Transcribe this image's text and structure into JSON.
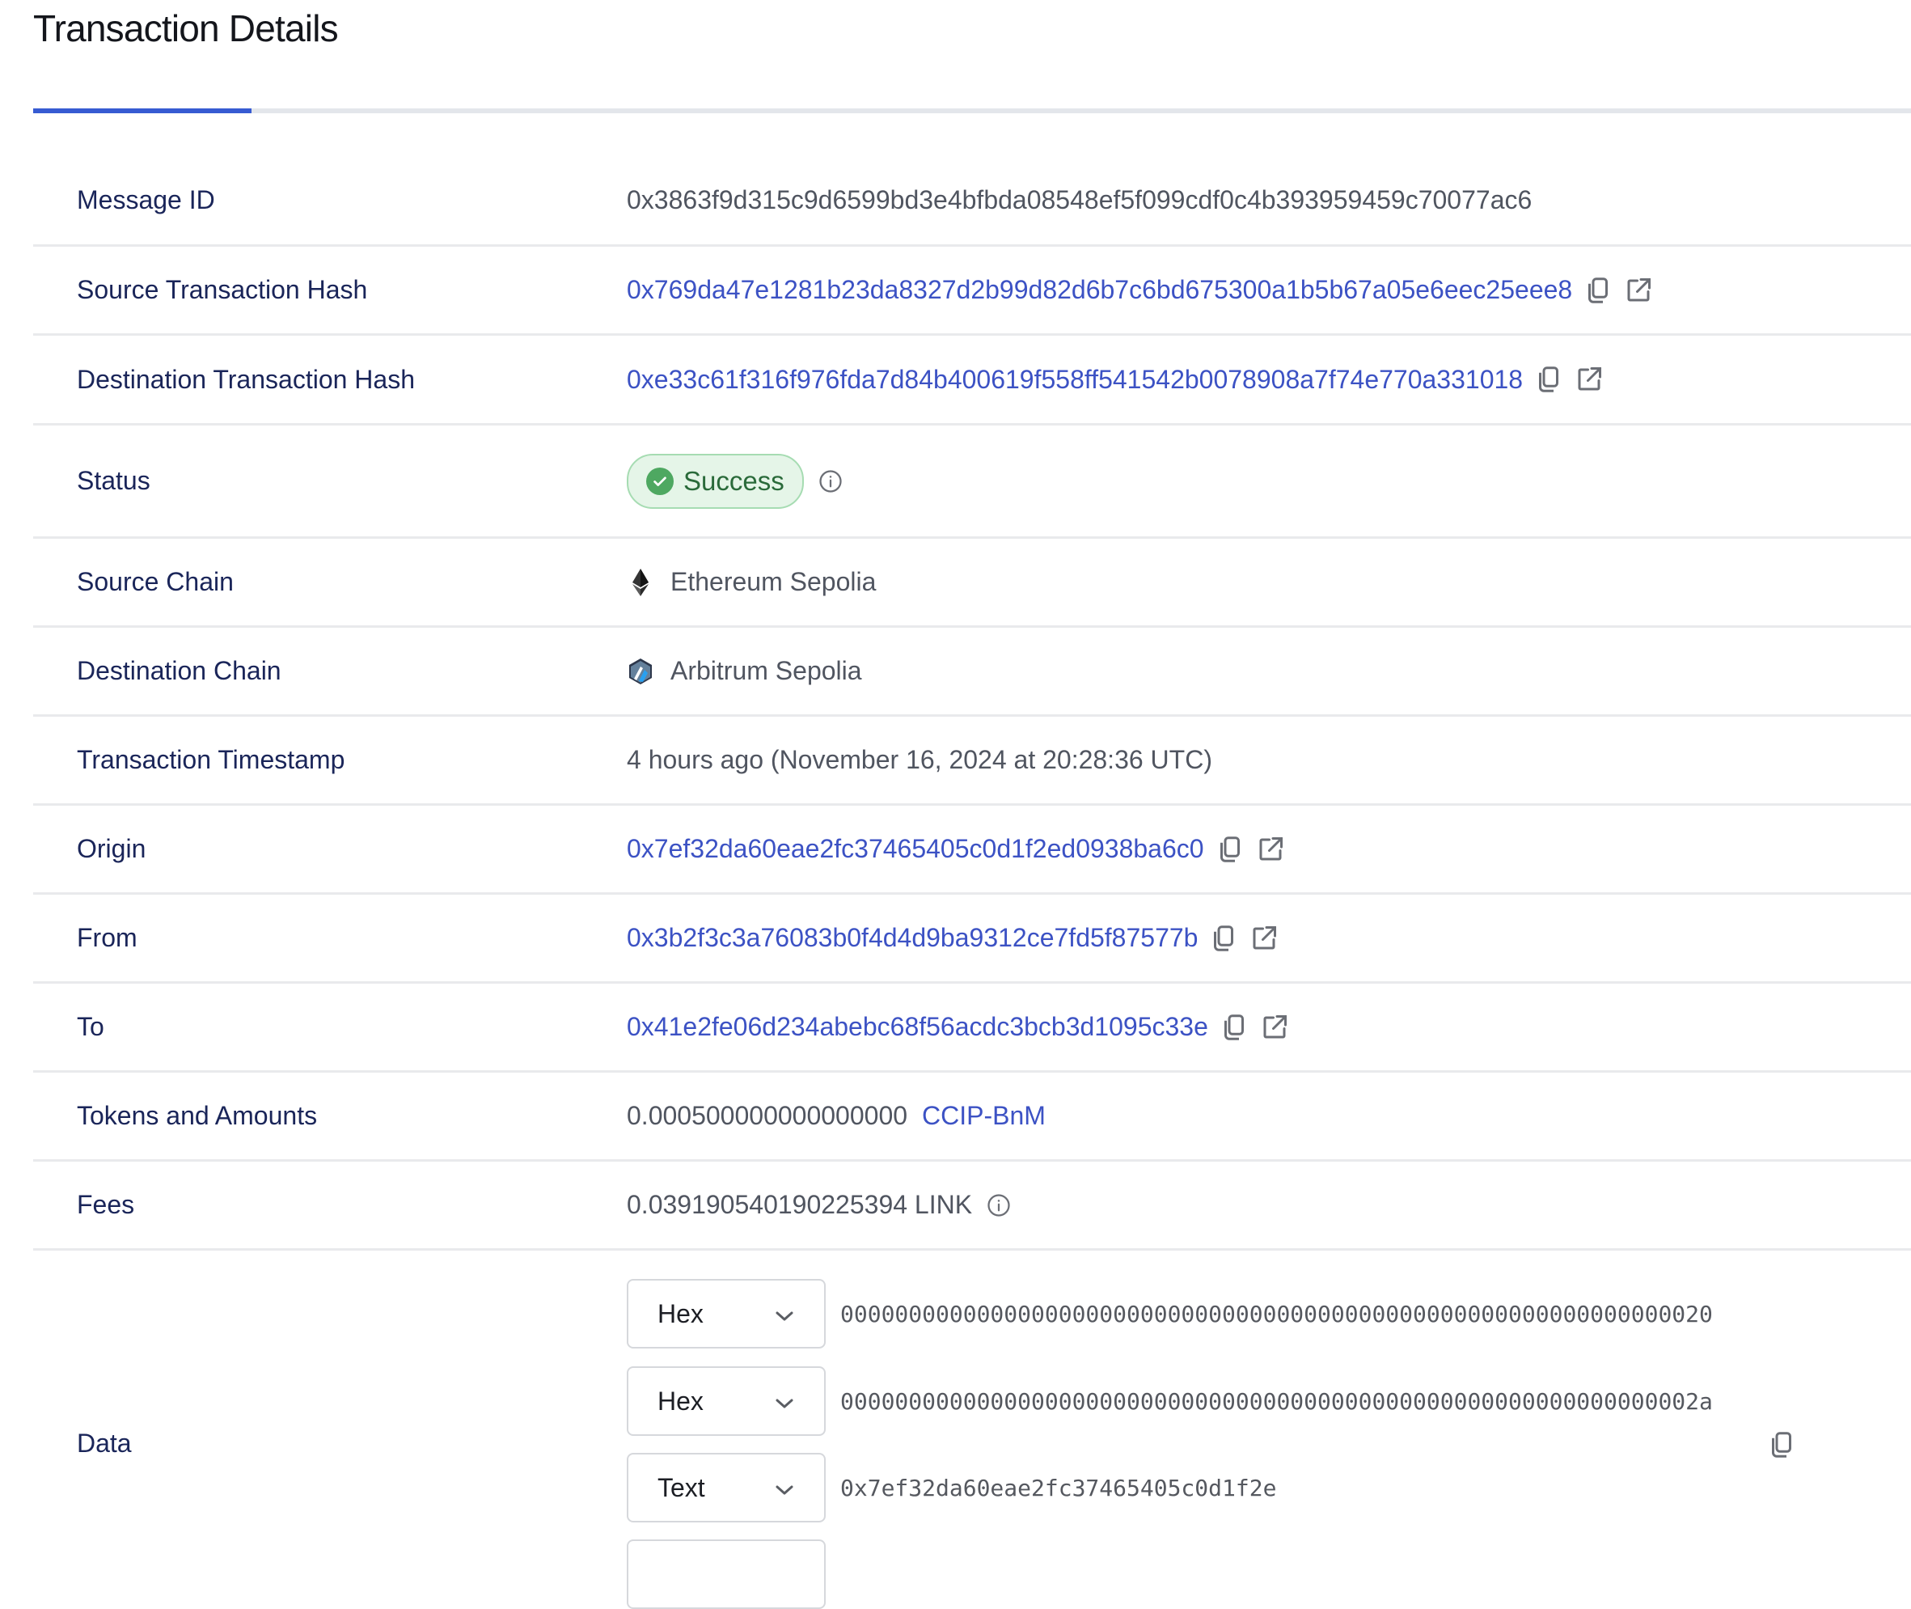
{
  "page": {
    "title": "Transaction Details",
    "active_tab_indicator": "tab-1"
  },
  "colors": {
    "accent": "#375bd2",
    "link": "#3c52c4",
    "label": "#1a2559",
    "success_bg": "#e5f5e8",
    "success_border": "#a6dcb2",
    "success_text": "#2a6a3a"
  },
  "rows": {
    "message_id": {
      "label": "Message ID",
      "value": "0x3863f9d315c9d6599bd3e4bfbda08548ef5f099cdf0c4b393959459c70077ac6"
    },
    "source_tx": {
      "label": "Source Transaction Hash",
      "value": "0x769da47e1281b23da8327d2b99d82d6b7c6bd675300a1b5b67a05e6eec25eee8",
      "copy_icon": "copy-icon",
      "link_icon": "external-link-icon"
    },
    "dest_tx": {
      "label": "Destination Transaction Hash",
      "value": "0xe33c61f316f976fda7d84b400619f558ff541542b0078908a7f74e770a331018",
      "copy_icon": "copy-icon",
      "link_icon": "external-link-icon"
    },
    "status": {
      "label": "Status",
      "value": "Success",
      "icon": "check-circle-icon",
      "info_icon": "info-icon"
    },
    "source_chain": {
      "label": "Source Chain",
      "value": "Ethereum Sepolia",
      "icon": "ethereum-icon"
    },
    "dest_chain": {
      "label": "Destination Chain",
      "value": "Arbitrum Sepolia",
      "icon": "arbitrum-icon"
    },
    "timestamp": {
      "label": "Transaction Timestamp",
      "value": "4 hours ago (November 16, 2024 at 20:28:36 UTC)"
    },
    "origin": {
      "label": "Origin",
      "value": "0x7ef32da60eae2fc37465405c0d1f2ed0938ba6c0"
    },
    "from": {
      "label": "From",
      "value": "0x3b2f3c3a76083b0f4d4d9ba9312ce7fd5f87577b"
    },
    "to": {
      "label": "To",
      "value": "0x41e2fe06d234abebc68f56acdc3bcb3d1095c33e"
    },
    "tokens": {
      "label": "Tokens and Amounts",
      "amount": "0.000500000000000000",
      "token": "CCIP-BnM"
    },
    "fees": {
      "label": "Fees",
      "value": "0.039190540190225394 LINK",
      "info_icon": "info-icon"
    },
    "data": {
      "label": "Data",
      "lines": [
        {
          "format": "Hex",
          "value": "0000000000000000000000000000000000000000000000000000000000000020"
        },
        {
          "format": "Hex",
          "value": "000000000000000000000000000000000000000000000000000000000000002a"
        },
        {
          "format": "Text",
          "value": "0x7ef32da60eae2fc37465405c0d1f2e"
        }
      ]
    }
  }
}
